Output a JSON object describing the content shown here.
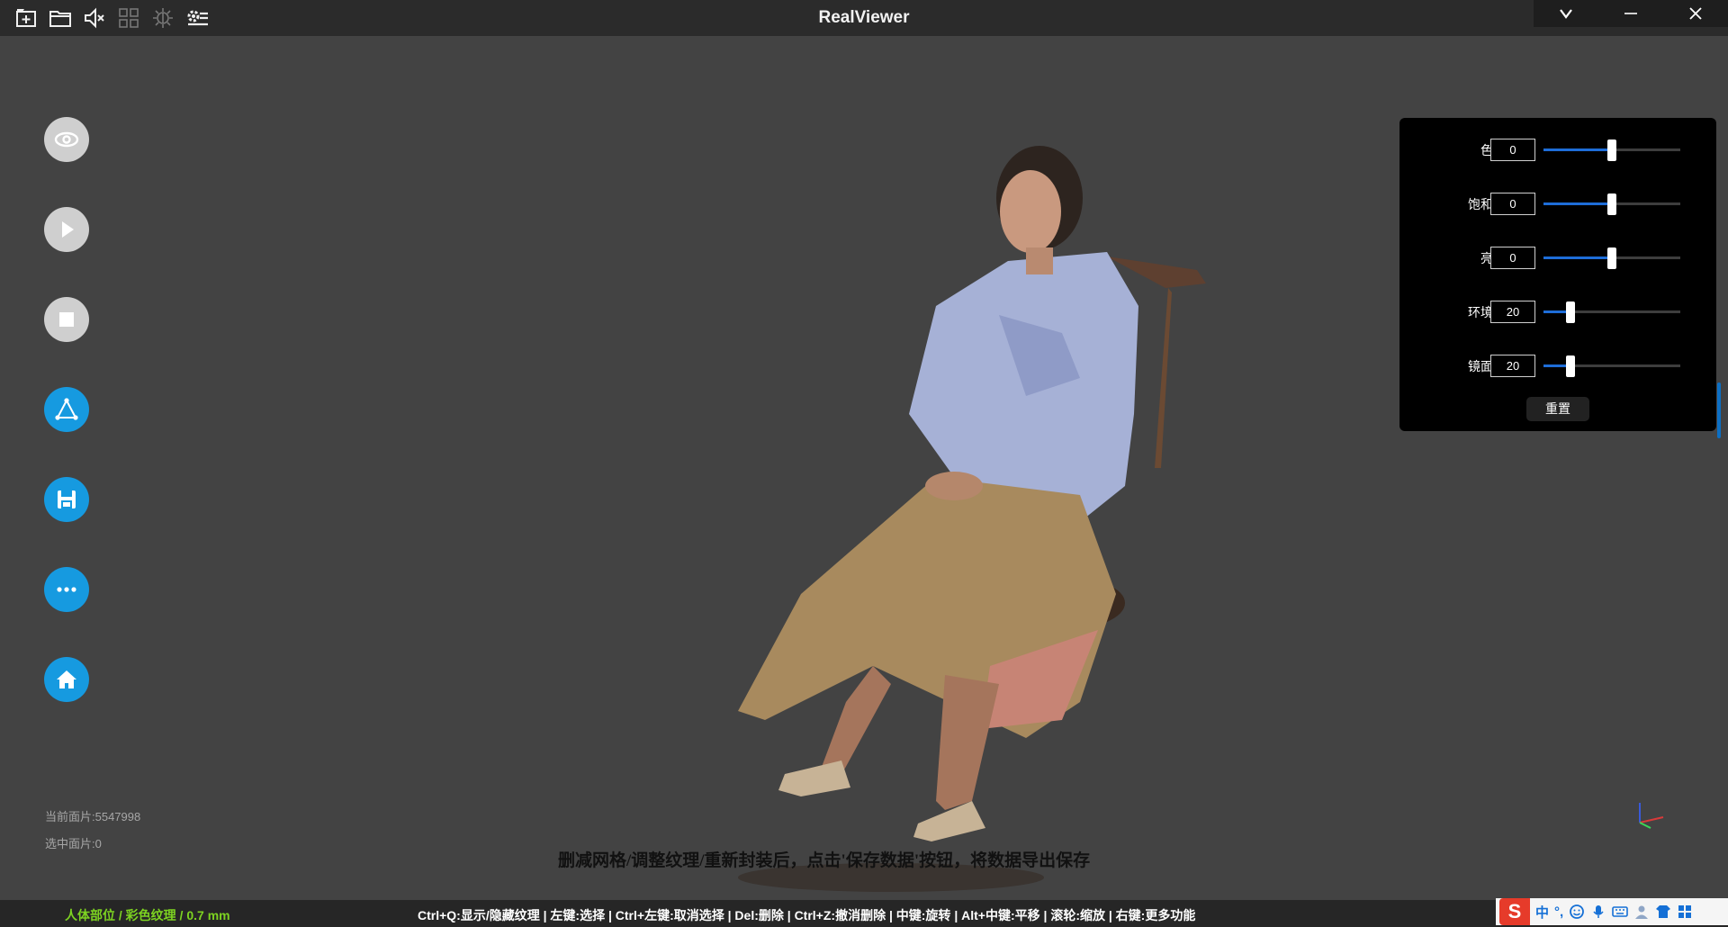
{
  "window": {
    "title": "RealViewer",
    "controls": [
      "collapse",
      "minimize",
      "close"
    ]
  },
  "toolbar": {
    "icons": [
      "new-project-icon",
      "open-folder-icon",
      "mute-icon",
      "grid-icon",
      "lighting-icon",
      "settings-icon"
    ]
  },
  "left_tools": [
    {
      "name": "eye-icon",
      "color": "#cfcfcf"
    },
    {
      "name": "play-icon",
      "color": "#cfcfcf"
    },
    {
      "name": "stop-icon",
      "color": "#cfcfcf"
    },
    {
      "name": "mesh-icon",
      "color": "#169ae0"
    },
    {
      "name": "save-icon",
      "color": "#169ae0"
    },
    {
      "name": "more-icon",
      "color": "#169ae0"
    },
    {
      "name": "home-icon",
      "color": "#169ae0"
    }
  ],
  "panel": {
    "rows": [
      {
        "label": "色调",
        "value": "0",
        "level": 0.5
      },
      {
        "label": "饱和度",
        "value": "0",
        "level": 0.5
      },
      {
        "label": "亮度",
        "value": "0",
        "level": 0.5
      },
      {
        "label": "环境光",
        "value": "20",
        "level": 0.2
      },
      {
        "label": "镜面光",
        "value": "20",
        "level": 0.2
      }
    ],
    "reset_label": "重置"
  },
  "stats": {
    "current_faces": "当前面片:5547998",
    "selected_faces": "选中面片:0"
  },
  "overlay_hint": "删减网格/调整纹理/重新封装后，点击'保存数据'按钮，将数据导出保存",
  "status": {
    "left": "人体部位 / 彩色纹理 / 0.7 mm",
    "shortcuts": "Ctrl+Q:显示/隐藏纹理 | 左键:选择 | Ctrl+左键:取消选择 | Del:删除 | Ctrl+Z:撤消删除 | 中键:旋转 | Alt+中键:平移 | 滚轮:缩放 | 右键:更多功能"
  },
  "ime": {
    "logo": "S",
    "mode": "中",
    "punct": "°,"
  },
  "colors": {
    "background": "#434343",
    "accent_blue": "#169ae0",
    "status_green": "#7dd321",
    "slider_fill": "#1e6dd8"
  }
}
